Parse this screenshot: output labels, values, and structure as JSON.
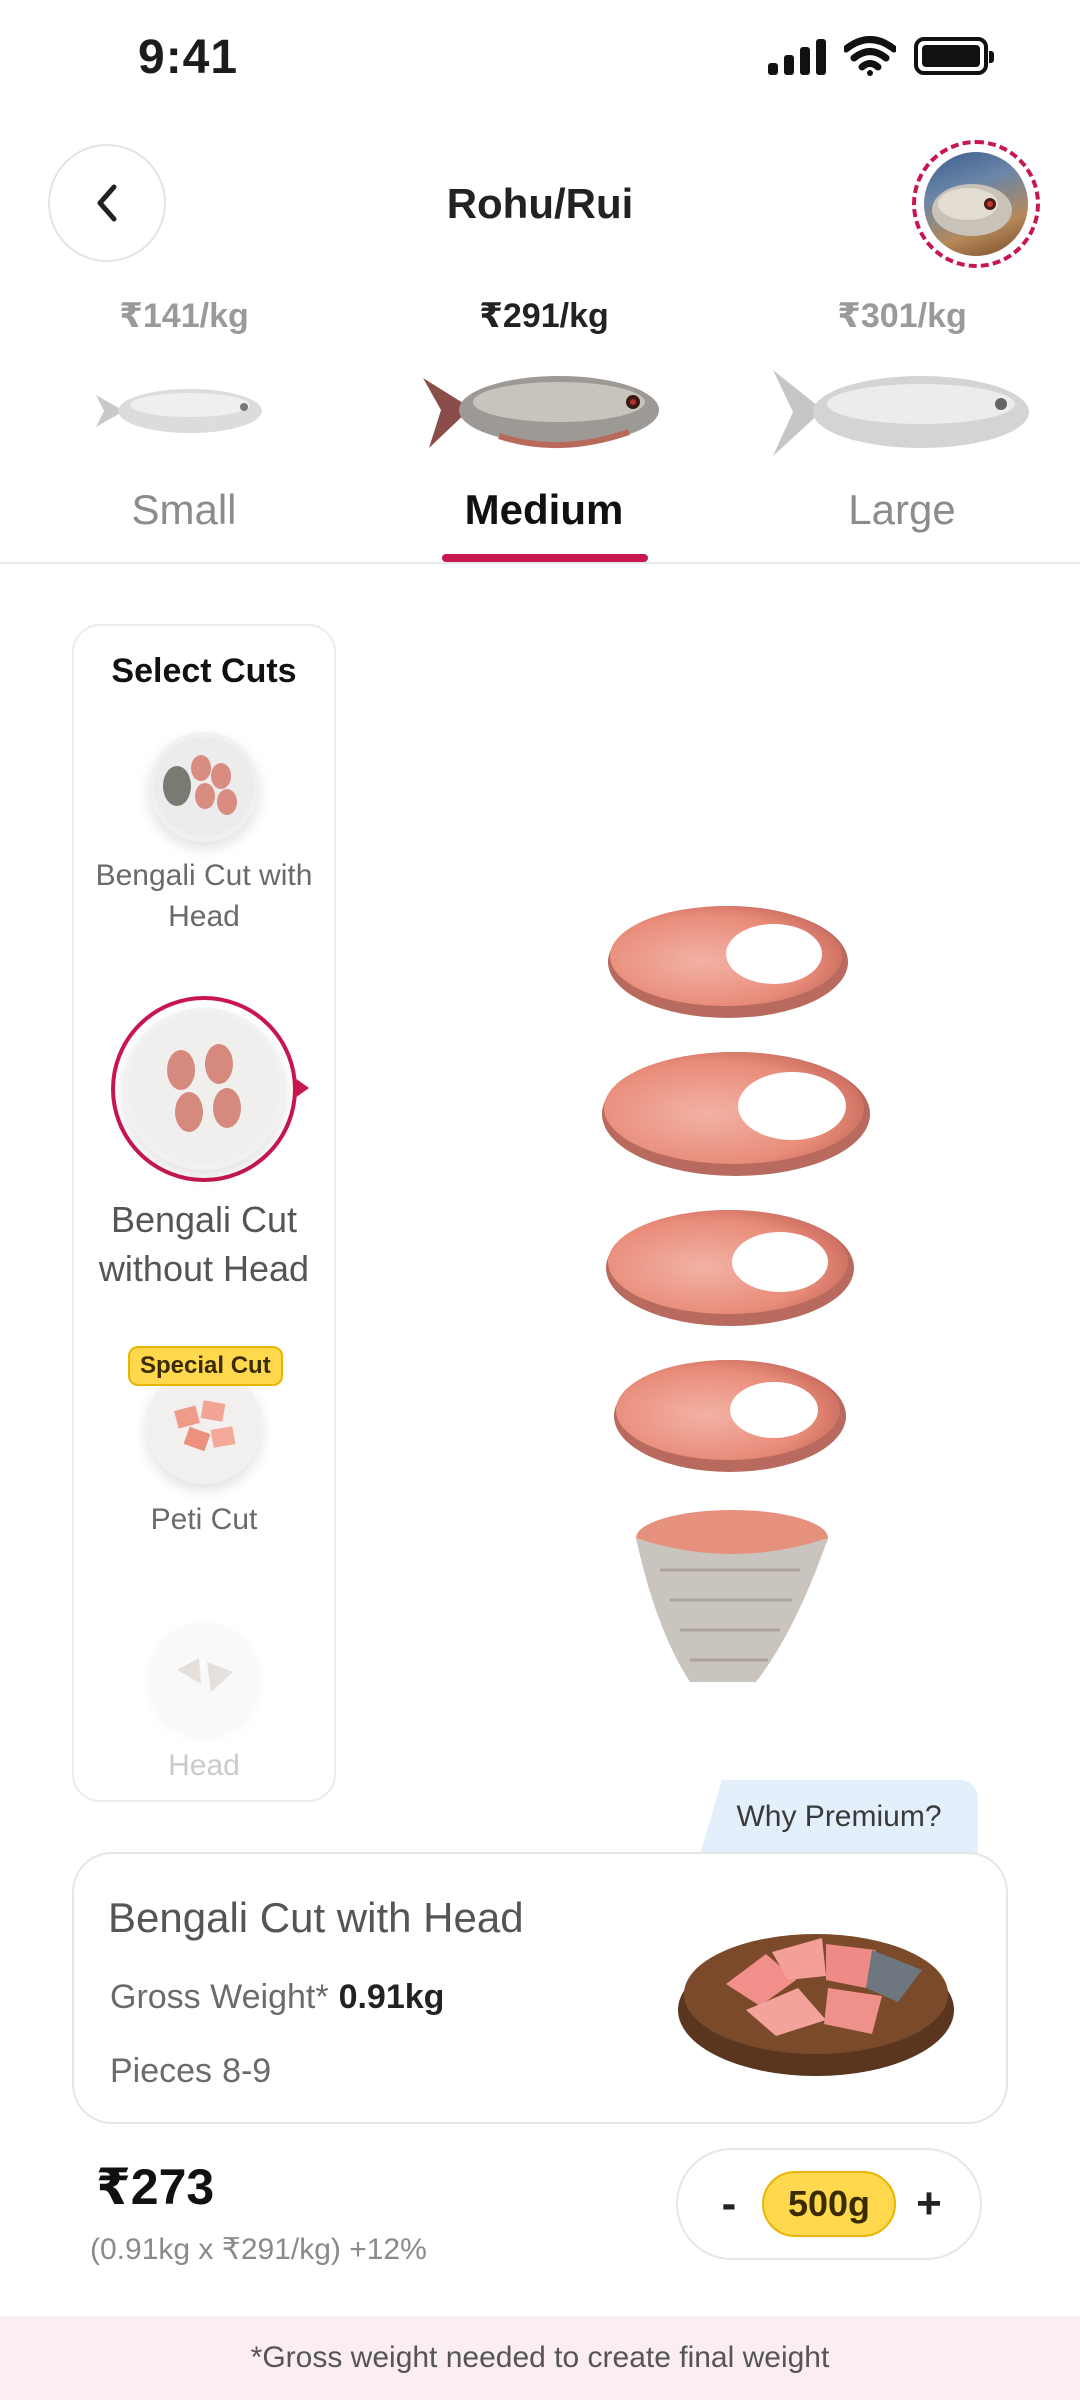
{
  "status_bar": {
    "time": "9:41"
  },
  "header": {
    "title": "Rohu/Rui",
    "back_icon": "chevron-left-icon",
    "avatar_icon": "fish-avatar"
  },
  "size_tabs": [
    {
      "price": "₹141/kg",
      "label": "Small",
      "active": false
    },
    {
      "price": "₹291/kg",
      "label": "Medium",
      "active": true
    },
    {
      "price": "₹301/kg",
      "label": "Large",
      "active": false
    }
  ],
  "cuts": {
    "title": "Select Cuts",
    "items": [
      {
        "label": "Bengali Cut with Head",
        "active": false
      },
      {
        "label": "Bengali Cut without Head",
        "active": true
      },
      {
        "label": "Peti Cut",
        "badge": "Special Cut",
        "active": false
      },
      {
        "label": "Head",
        "active": false
      }
    ]
  },
  "why_premium": "Why Premium?",
  "product": {
    "name": "Bengali Cut with Head",
    "gross_weight_label": "Gross Weight*",
    "gross_weight_value": "0.91kg",
    "pieces_label": "Pieces",
    "pieces_value": "8-9"
  },
  "pricing": {
    "total": "₹273",
    "calc": "(0.91kg x ₹291/kg) +12%"
  },
  "quantity": {
    "minus": "-",
    "value": "500g",
    "plus": "+"
  },
  "footer": {
    "note": "*Gross weight needed to create final weight"
  },
  "colors": {
    "accent": "#c8174e",
    "badge": "#ffd84d",
    "premium_bg": "#e3f0fb",
    "footer_bg": "#fbeef1"
  }
}
